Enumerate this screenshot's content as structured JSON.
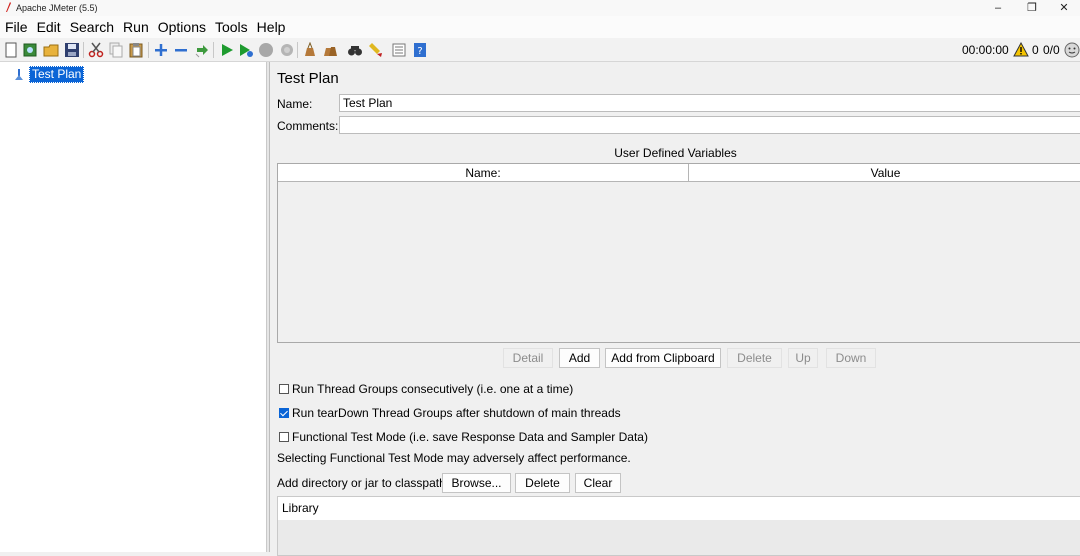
{
  "window": {
    "title": "Apache JMeter (5.5)",
    "minimize": "–",
    "restore": "❐",
    "close": "✕"
  },
  "menu": [
    "File",
    "Edit",
    "Search",
    "Run",
    "Options",
    "Tools",
    "Help"
  ],
  "toolbar": {
    "icons": [
      "new-icon",
      "templates-icon",
      "open-icon",
      "save-icon",
      "cut-icon",
      "copy-icon",
      "paste-icon",
      "expand-icon",
      "collapse-icon",
      "toggle-icon",
      "start-icon",
      "start-no-pauses-icon",
      "stop-icon",
      "shutdown-icon",
      "clear-icon",
      "clear-all-icon",
      "search-icon",
      "reset-search-icon",
      "function-helper-icon",
      "help-icon"
    ],
    "timer": "00:00:00",
    "warning_count": "0",
    "threads": "0/0"
  },
  "tree": {
    "root_label": "Test Plan"
  },
  "test_plan": {
    "title": "Test Plan",
    "name_label": "Name:",
    "name_value": "Test Plan",
    "comments_label": "Comments:",
    "comments_value": "",
    "udv_title": "User Defined Variables",
    "columns": [
      "Name:",
      "Value"
    ],
    "buttons": {
      "detail": "Detail",
      "add": "Add",
      "add_clipboard": "Add from Clipboard",
      "delete": "Delete",
      "up": "Up",
      "down": "Down"
    },
    "options": {
      "serial": {
        "label": "Run Thread Groups consecutively (i.e. one at a time)",
        "checked": false
      },
      "teardown": {
        "label": "Run tearDown Thread Groups after shutdown of main threads",
        "checked": true
      },
      "functional": {
        "label": "Functional Test Mode (i.e. save Response Data and Sampler Data)",
        "checked": false
      }
    },
    "functional_note": "Selecting Functional Test Mode may adversely affect performance.",
    "classpath_label": "Add directory or jar to classpath",
    "classpath_buttons": {
      "browse": "Browse...",
      "delete": "Delete",
      "clear": "Clear"
    },
    "library_header": "Library"
  },
  "colors": {
    "selection": "#0a64d6",
    "start_green": "#1e9b2f",
    "warning_yellow": "#f5c400"
  }
}
